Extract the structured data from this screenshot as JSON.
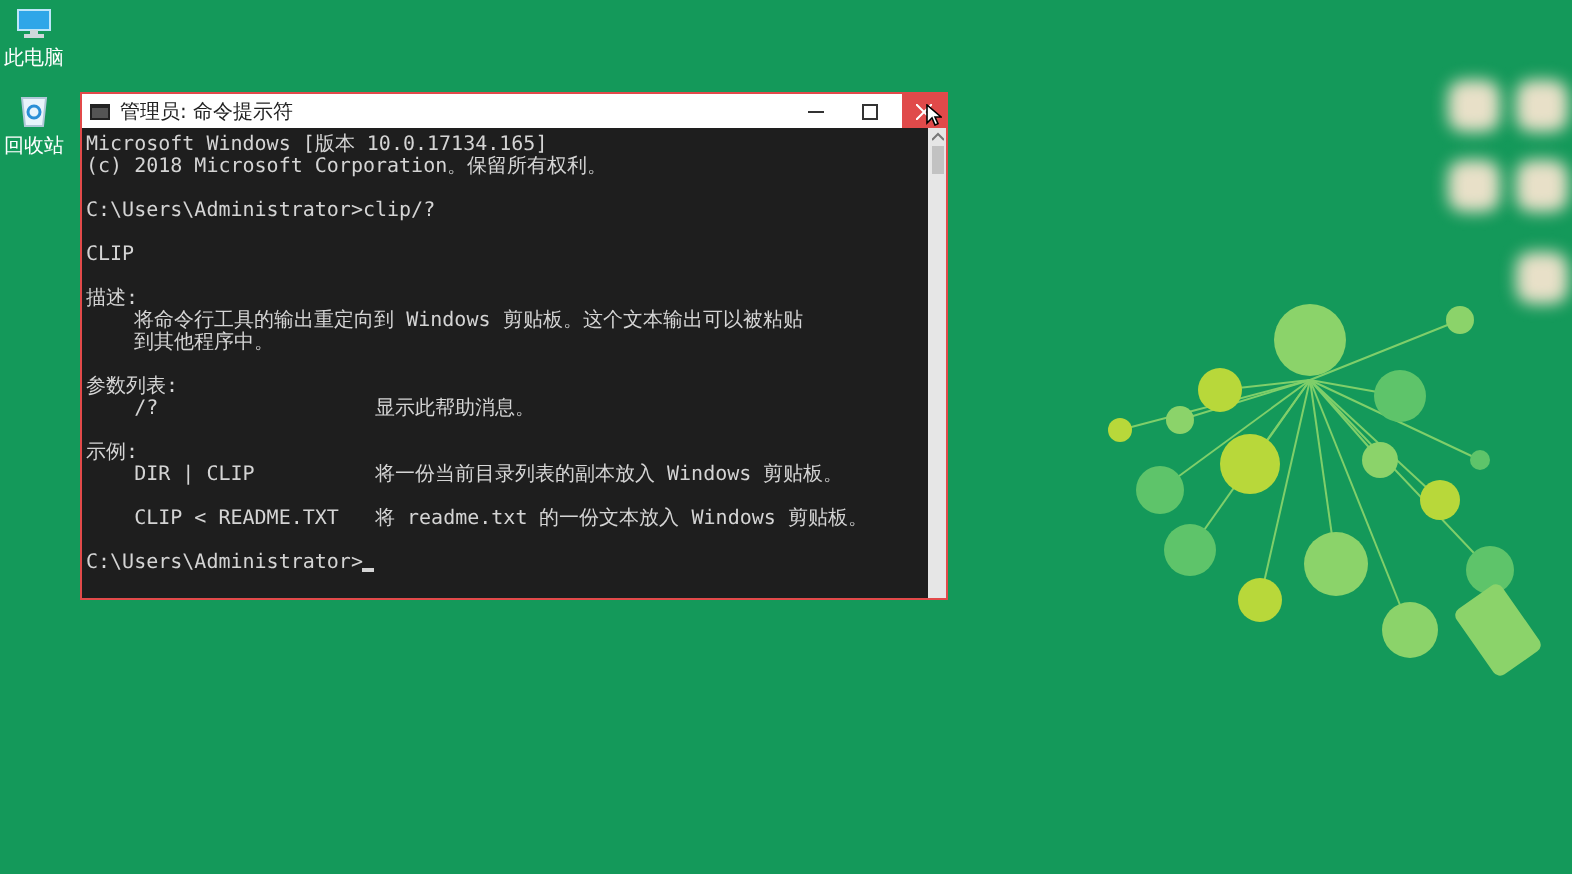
{
  "desktop_icons": [
    {
      "label": "此电脑",
      "kind": "computer"
    },
    {
      "label": "回收站",
      "kind": "recycle"
    }
  ],
  "window": {
    "title": "管理员: 命令提示符",
    "console_blocks": [
      [
        "Microsoft Windows [版本 10.0.17134.165]",
        "(c) 2018 Microsoft Corporation。保留所有权利。"
      ],
      [
        "C:\\Users\\Administrator>clip/?"
      ],
      [
        "CLIP"
      ],
      [
        "描述:",
        "    将命令行工具的输出重定向到 Windows 剪贴板。这个文本输出可以被粘贴",
        "    到其他程序中。"
      ],
      [
        "参数列表:",
        "    /?                  显示此帮助消息。"
      ],
      [
        "示例:",
        "    DIR | CLIP          将一份当前目录列表的副本放入 Windows 剪贴板。"
      ],
      [
        "    CLIP < README.TXT   将 readme.txt 的一份文本放入 Windows 剪贴板。"
      ],
      [
        "C:\\Users\\Administrator>"
      ]
    ]
  }
}
